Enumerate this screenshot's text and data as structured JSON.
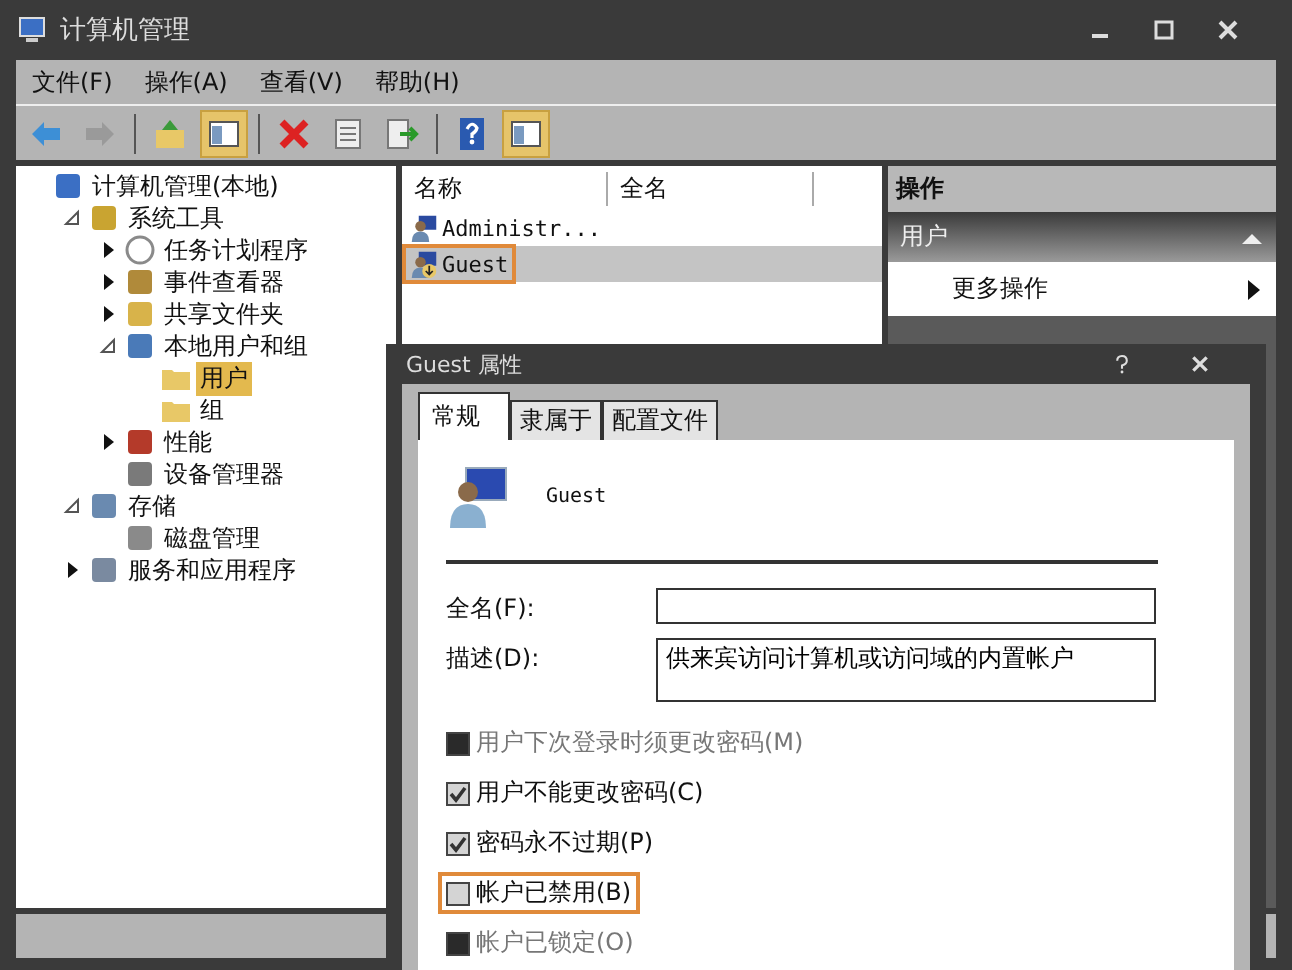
{
  "window": {
    "title": "计算机管理"
  },
  "menu": [
    "文件(F)",
    "操作(A)",
    "查看(V)",
    "帮助(H)"
  ],
  "toolbar": [
    [
      {
        "kind": "back",
        "on": false
      },
      {
        "kind": "forward",
        "on": false
      }
    ],
    [
      {
        "kind": "up",
        "on": false
      },
      {
        "kind": "tree",
        "on": true
      }
    ],
    [
      {
        "kind": "delete",
        "on": false
      },
      {
        "kind": "props",
        "on": false
      },
      {
        "kind": "export",
        "on": false
      }
    ],
    [
      {
        "kind": "help",
        "on": false
      },
      {
        "kind": "pane",
        "on": true
      }
    ]
  ],
  "tree": [
    {
      "label": "计算机管理(本地)",
      "kind": "computer",
      "selected": false,
      "children": [
        {
          "label": "系统工具",
          "kind": "tools",
          "expanded": true,
          "selected": false,
          "children": [
            {
              "label": "任务计划程序",
              "kind": "clock",
              "expanded": false,
              "selected": false
            },
            {
              "label": "事件查看器",
              "kind": "log",
              "expanded": false,
              "selected": false
            },
            {
              "label": "共享文件夹",
              "kind": "share",
              "expanded": false,
              "selected": false
            },
            {
              "label": "本地用户和组",
              "kind": "users",
              "expanded": true,
              "selected": false,
              "children": [
                {
                  "label": "用户",
                  "kind": "folder",
                  "selected": true
                },
                {
                  "label": "组",
                  "kind": "folder",
                  "selected": false
                }
              ]
            },
            {
              "label": "性能",
              "kind": "perf",
              "expanded": false,
              "selected": false
            },
            {
              "label": "设备管理器",
              "kind": "device",
              "selected": false
            }
          ]
        },
        {
          "label": "存储",
          "kind": "storage",
          "expanded": true,
          "selected": false,
          "children": [
            {
              "label": "磁盘管理",
              "kind": "disk",
              "selected": false
            }
          ]
        },
        {
          "label": "服务和应用程序",
          "kind": "services",
          "expanded": false,
          "selected": false
        }
      ]
    }
  ],
  "list": {
    "columns": [
      "名称",
      "全名"
    ],
    "rows": [
      {
        "name": "Administr...",
        "disabled": false,
        "selected": false
      },
      {
        "name": "Guest",
        "disabled": true,
        "selected": true
      }
    ]
  },
  "actions": {
    "header": "操作",
    "section": {
      "title": "用户",
      "expanded": true
    },
    "items": [
      "更多操作"
    ]
  },
  "dialog": {
    "title": "Guest 属性",
    "tabs": [
      {
        "label": "常规",
        "selected": true
      },
      {
        "label": "隶属于",
        "selected": false
      },
      {
        "label": "配置文件",
        "selected": false
      }
    ],
    "user": "Guest",
    "fields": [
      {
        "label": "全名(F):",
        "multiline": false
      },
      {
        "label": "描述(D):",
        "value": "供来宾访问计算机或访问域的内置帐户",
        "multiline": true
      }
    ],
    "options": [
      {
        "label": "用户下次登录时须更改密码(M)",
        "checked": false,
        "disabled": true,
        "highlighted": false
      },
      {
        "label": "用户不能更改密码(C)",
        "checked": true,
        "disabled": false,
        "highlighted": false
      },
      {
        "label": "密码永不过期(P)",
        "checked": true,
        "disabled": false,
        "highlighted": false
      },
      {
        "label": "帐户已禁用(B)",
        "checked": false,
        "disabled": false,
        "highlighted": true
      },
      {
        "label": "帐户已锁定(O)",
        "checked": false,
        "disabled": true,
        "highlighted": false
      }
    ]
  }
}
